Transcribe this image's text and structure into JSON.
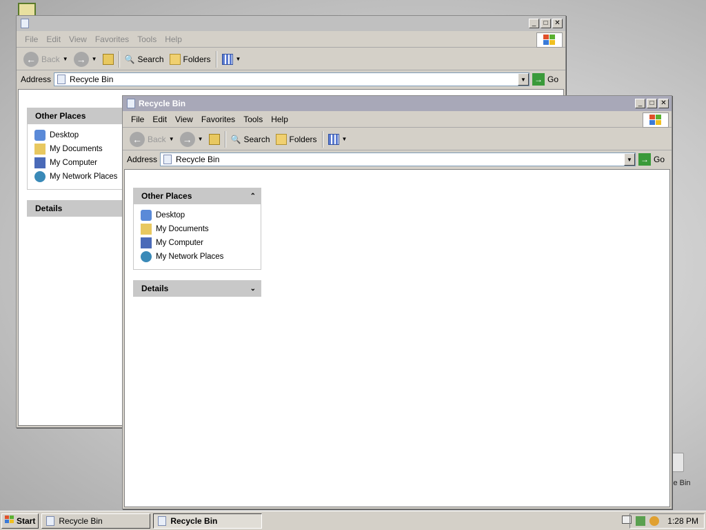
{
  "back_window": {
    "title": "",
    "menu": [
      "File",
      "Edit",
      "View",
      "Favorites",
      "Tools",
      "Help"
    ],
    "toolbar": {
      "back": "Back",
      "search": "Search",
      "folders": "Folders"
    },
    "address_label": "Address",
    "address_value": "Recycle Bin",
    "go": "Go",
    "other_places": {
      "title": "Other Places",
      "items": [
        "Desktop",
        "My Documents",
        "My Computer",
        "My Network Places"
      ]
    },
    "details_title": "Details"
  },
  "front_window": {
    "title": "Recycle Bin",
    "menu": [
      "File",
      "Edit",
      "View",
      "Favorites",
      "Tools",
      "Help"
    ],
    "toolbar": {
      "back": "Back",
      "search": "Search",
      "folders": "Folders"
    },
    "address_label": "Address",
    "address_value": "Recycle Bin",
    "go": "Go",
    "other_places": {
      "title": "Other Places",
      "items": [
        "Desktop",
        "My Documents",
        "My Computer",
        "My Network Places"
      ]
    },
    "details_title": "Details"
  },
  "desktop": {
    "recycle_bin_label": "le Bin"
  },
  "taskbar": {
    "start": "Start",
    "buttons": [
      {
        "label": "Recycle Bin",
        "active": false
      },
      {
        "label": "Recycle Bin",
        "active": true
      }
    ],
    "clock": "1:28 PM"
  },
  "colors": {
    "titlebar_active": "#6e6e9e",
    "titlebar_inactive": "#a0a0a0",
    "go_green": "#3a9a3a"
  }
}
